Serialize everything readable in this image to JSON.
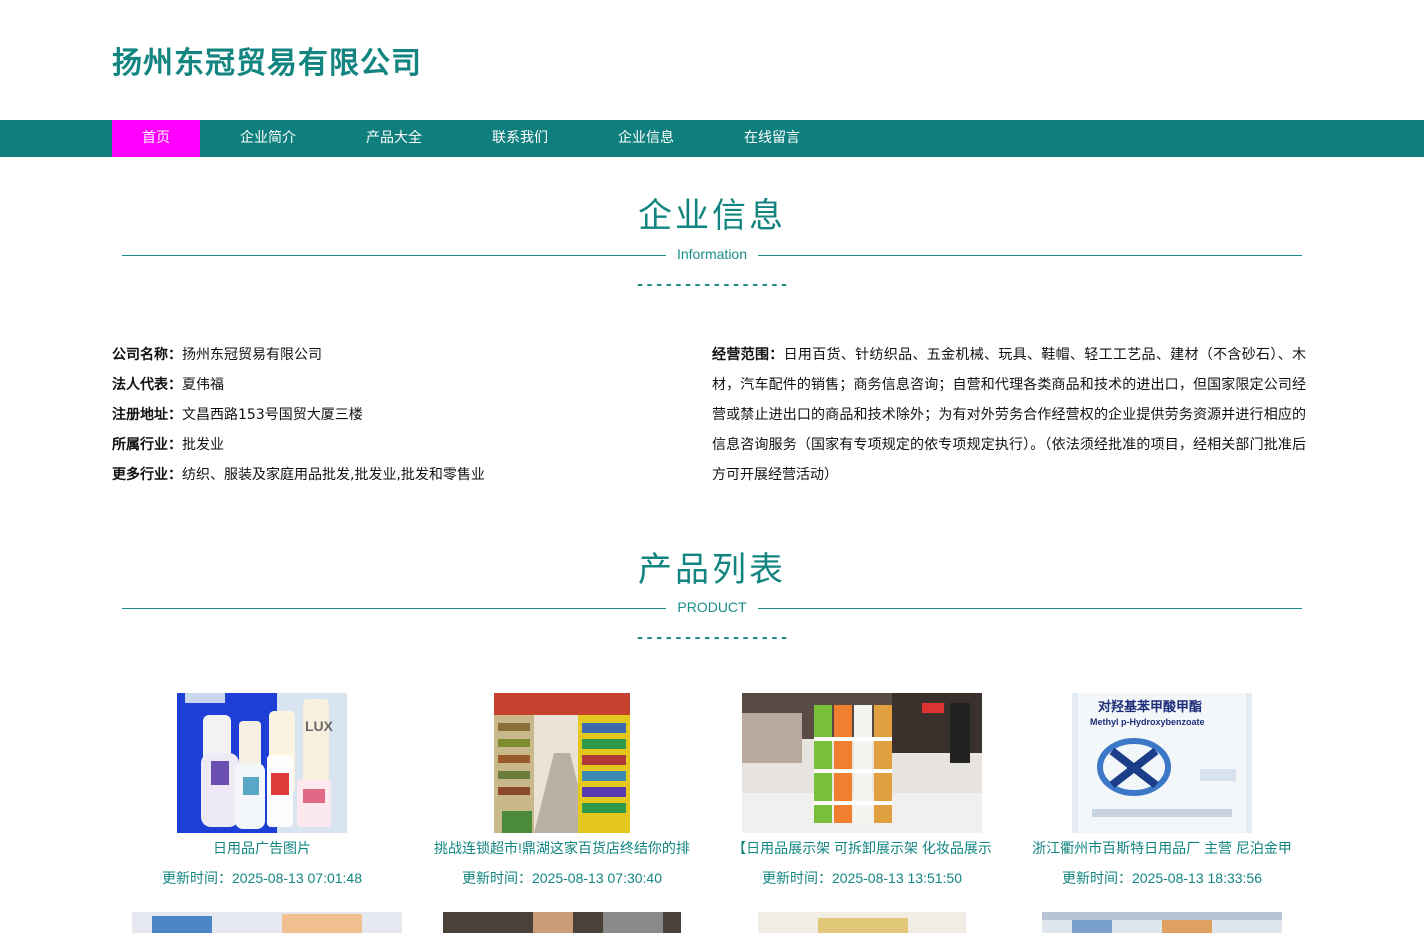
{
  "site": {
    "title": "扬州东冠贸易有限公司"
  },
  "nav": {
    "items": [
      {
        "label": "首页",
        "active": true
      },
      {
        "label": "企业简介",
        "active": false
      },
      {
        "label": "产品大全",
        "active": false
      },
      {
        "label": "联系我们",
        "active": false
      },
      {
        "label": "企业信息",
        "active": false
      },
      {
        "label": "在线留言",
        "active": false
      }
    ]
  },
  "info_section": {
    "title": "企业信息",
    "subtitle": "Information",
    "dashes": "----------------"
  },
  "company": {
    "fields": [
      {
        "key": "公司名称：",
        "value": "扬州东冠贸易有限公司"
      },
      {
        "key": "法人代表：",
        "value": "夏伟福"
      },
      {
        "key": "注册地址：",
        "value": "文昌西路153号国贸大厦三楼"
      },
      {
        "key": "所属行业：",
        "value": "批发业"
      },
      {
        "key": "更多行业：",
        "value": "纺织、服装及家庭用品批发,批发业,批发和零售业"
      }
    ],
    "scope_key": "经营范围：",
    "scope_value": "日用百货、针纺织品、五金机械、玩具、鞋帽、轻工工艺品、建材（不含砂石）、木材，汽车配件的销售；商务信息咨询；自营和代理各类商品和技术的进出口，但国家限定公司经营或禁止进出口的商品和技术除外；为有对外劳务合作经营权的企业提供劳务资源并进行相应的信息咨询服务（国家有专项规定的依专项规定执行）。（依法须经批准的项目，经相关部门批准后方可开展经营活动）"
  },
  "product_section": {
    "title": "产品列表",
    "subtitle": "PRODUCT",
    "dashes": "----------------"
  },
  "products": [
    {
      "name": "日用品广告图片",
      "date": "更新时间：2025-08-13 07:01:48"
    },
    {
      "name": "挑战连锁超市!鼎湖这家百货店终结你的排",
      "date": "更新时间：2025-08-13 07:30:40"
    },
    {
      "name": "【日用品展示架 可拆卸展示架 化妆品展示",
      "date": "更新时间：2025-08-13 13:51:50"
    },
    {
      "name": "浙江衢州市百斯特日用品厂 主营 尼泊金甲",
      "date": "更新时间：2025-08-13 18:33:56"
    }
  ],
  "image_text": {
    "p1_brand": "LUX",
    "p4_line1": "对羟基苯甲酸甲酯",
    "p4_line2": "Methyl p-Hydroxybenzoate"
  },
  "colors": {
    "primary": "#138581",
    "nav_bg": "#0e7f7d",
    "nav_active": "#ff00ff"
  }
}
